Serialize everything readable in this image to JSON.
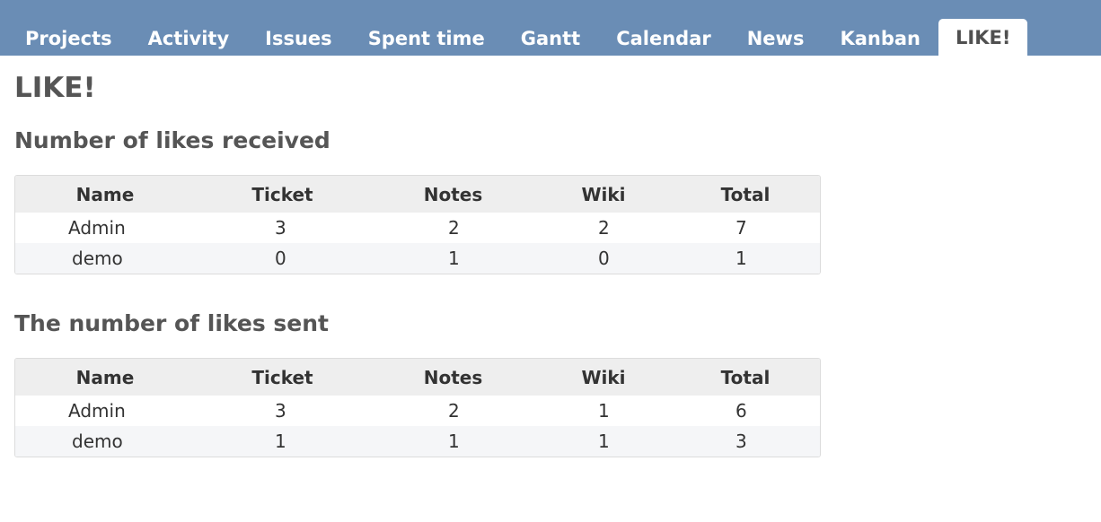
{
  "nav": {
    "tabs": [
      {
        "label": "Projects"
      },
      {
        "label": "Activity"
      },
      {
        "label": "Issues"
      },
      {
        "label": "Spent time"
      },
      {
        "label": "Gantt"
      },
      {
        "label": "Calendar"
      },
      {
        "label": "News"
      },
      {
        "label": "Kanban"
      },
      {
        "label": "LIKE!"
      }
    ],
    "selected": "LIKE!"
  },
  "page": {
    "title": "LIKE!"
  },
  "received": {
    "heading": "Number of likes received",
    "headers": [
      "Name",
      "Ticket",
      "Notes",
      "Wiki",
      "Total"
    ],
    "rows": [
      [
        "Admin",
        "3",
        "2",
        "2",
        "7"
      ],
      [
        "demo",
        "0",
        "1",
        "0",
        "1"
      ]
    ]
  },
  "sent": {
    "heading": "The number of likes sent",
    "headers": [
      "Name",
      "Ticket",
      "Notes",
      "Wiki",
      "Total"
    ],
    "rows": [
      [
        "Admin",
        "3",
        "2",
        "1",
        "6"
      ],
      [
        "demo",
        "1",
        "1",
        "1",
        "3"
      ]
    ]
  },
  "colors": {
    "nav_bg": "#6a8db5",
    "header_bg": "#eeeeee",
    "row_alt_bg": "#f5f6f8",
    "text": "#505050"
  }
}
